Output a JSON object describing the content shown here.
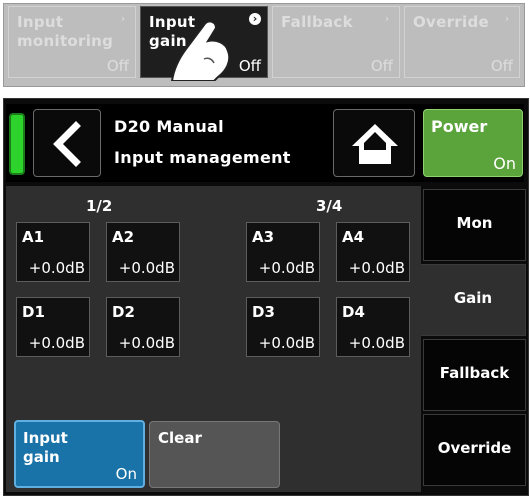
{
  "top_strip": {
    "buttons": [
      {
        "label": "Input\nmonitoring",
        "value": "Off",
        "active": false
      },
      {
        "label": "Input\ngain",
        "value": "Off",
        "active": true
      },
      {
        "label": "Fallback",
        "value": "Off",
        "active": false
      },
      {
        "label": "Override",
        "value": "Off",
        "active": false
      }
    ]
  },
  "header": {
    "device_name": "D20 Manual",
    "screen_title": "Input management",
    "power_label": "Power",
    "power_value": "On"
  },
  "groups": {
    "left_label": "1/2",
    "right_label": "3/4"
  },
  "channels": [
    {
      "name": "A1",
      "gain": "+0.0dB"
    },
    {
      "name": "A2",
      "gain": "+0.0dB"
    },
    {
      "name": "A3",
      "gain": "+0.0dB"
    },
    {
      "name": "A4",
      "gain": "+0.0dB"
    },
    {
      "name": "D1",
      "gain": "+0.0dB"
    },
    {
      "name": "D2",
      "gain": "+0.0dB"
    },
    {
      "name": "D3",
      "gain": "+0.0dB"
    },
    {
      "name": "D4",
      "gain": "+0.0dB"
    }
  ],
  "bottom": {
    "input_gain_label": "Input\ngain",
    "input_gain_value": "On",
    "clear_label": "Clear"
  },
  "tabs": [
    {
      "label": "Mon",
      "selected": false
    },
    {
      "label": "Gain",
      "selected": true
    },
    {
      "label": "Fallback",
      "selected": false
    },
    {
      "label": "Override",
      "selected": false
    }
  ],
  "colors": {
    "power_green": "#5aa43b",
    "status_led": "#2dd22d",
    "active_blue": "#1a73a8"
  },
  "icons": {
    "back": "chevron-left-icon",
    "home": "home-icon",
    "pointer": "hand-pointer-icon",
    "chevron": "chevron-right-icon"
  }
}
